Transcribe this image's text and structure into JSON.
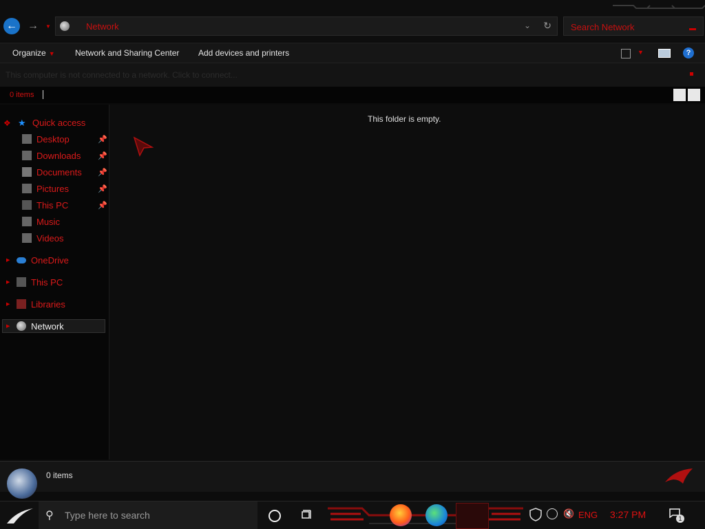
{
  "address_bar": {
    "location": "Network"
  },
  "search_box": {
    "placeholder": "Search Network"
  },
  "command_bar": {
    "organize_label": "Organize",
    "network_sharing_label": "Network and Sharing Center",
    "add_devices_label": "Add devices and printers",
    "help_label": "?"
  },
  "info_bar": {
    "message": "This computer is not connected to a network. Click to connect..."
  },
  "items_header": {
    "count_label": "0 items"
  },
  "nav_pane": {
    "quick_access": "Quick access",
    "quick_access_items": [
      {
        "label": "Desktop"
      },
      {
        "label": "Downloads"
      },
      {
        "label": "Documents"
      },
      {
        "label": "Pictures"
      },
      {
        "label": "This PC"
      },
      {
        "label": "Music"
      },
      {
        "label": "Videos"
      }
    ],
    "onedrive": "OneDrive",
    "this_pc": "This PC",
    "libraries": "Libraries",
    "network": "Network"
  },
  "content": {
    "empty_message": "This folder is empty."
  },
  "details_pane": {
    "count_label": "0 items"
  },
  "taskbar": {
    "search_placeholder": "Type here to search",
    "language": "ENG",
    "time": "3:27 PM",
    "notification_count": "1"
  },
  "colors": {
    "accent": "#dd1a1a",
    "background": "#0c0c0c",
    "selection": "#1a1a1a"
  }
}
